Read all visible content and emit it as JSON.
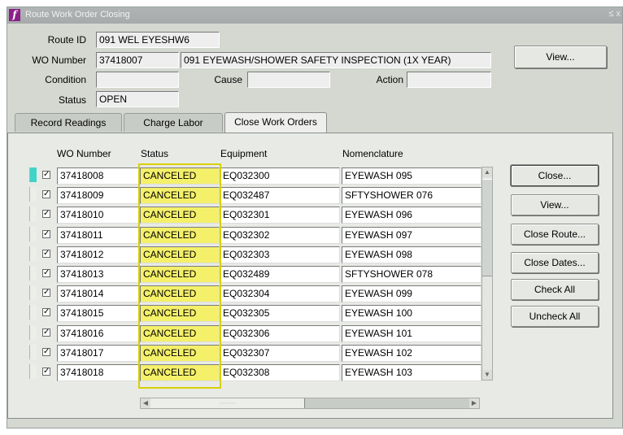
{
  "window": {
    "title": "Route Work Order Closing",
    "controls": "≤ x"
  },
  "header": {
    "route_id_label": "Route ID",
    "route_id_value": "091 WEL EYESHW6",
    "wo_number_label": "WO Number",
    "wo_number_value": "37418007",
    "wo_description": "091 EYEWASH/SHOWER SAFETY INSPECTION (1X YEAR)",
    "condition_label": "Condition",
    "condition_value": "",
    "cause_label": "Cause",
    "cause_value": "",
    "action_label": "Action",
    "action_value": "",
    "status_label": "Status",
    "status_value": "OPEN",
    "view_button": "View..."
  },
  "tabs": [
    {
      "label": "Record Readings",
      "active": false
    },
    {
      "label": "Charge Labor",
      "active": false
    },
    {
      "label": "Close Work Orders",
      "active": true
    }
  ],
  "table": {
    "columns": [
      "WO Number",
      "Status",
      "Equipment",
      "Nomenclature"
    ],
    "rows": [
      {
        "wo": "37418008",
        "status": "CANCELED",
        "equipment": "EQ032300",
        "nomenclature": "EYEWASH 095",
        "checked": true
      },
      {
        "wo": "37418009",
        "status": "CANCELED",
        "equipment": "EQ032487",
        "nomenclature": "SFTYSHOWER 076",
        "checked": true
      },
      {
        "wo": "37418010",
        "status": "CANCELED",
        "equipment": "EQ032301",
        "nomenclature": "EYEWASH 096",
        "checked": true
      },
      {
        "wo": "37418011",
        "status": "CANCELED",
        "equipment": "EQ032302",
        "nomenclature": "EYEWASH 097",
        "checked": true
      },
      {
        "wo": "37418012",
        "status": "CANCELED",
        "equipment": "EQ032303",
        "nomenclature": "EYEWASH 098",
        "checked": true
      },
      {
        "wo": "37418013",
        "status": "CANCELED",
        "equipment": "EQ032489",
        "nomenclature": "SFTYSHOWER 078",
        "checked": true
      },
      {
        "wo": "37418014",
        "status": "CANCELED",
        "equipment": "EQ032304",
        "nomenclature": "EYEWASH 099",
        "checked": true
      },
      {
        "wo": "37418015",
        "status": "CANCELED",
        "equipment": "EQ032305",
        "nomenclature": "EYEWASH 100",
        "checked": true
      },
      {
        "wo": "37418016",
        "status": "CANCELED",
        "equipment": "EQ032306",
        "nomenclature": "EYEWASH 101",
        "checked": true
      },
      {
        "wo": "37418017",
        "status": "CANCELED",
        "equipment": "EQ032307",
        "nomenclature": "EYEWASH 102",
        "checked": true
      },
      {
        "wo": "37418018",
        "status": "CANCELED",
        "equipment": "EQ032308",
        "nomenclature": "EYEWASH 103",
        "checked": true
      }
    ]
  },
  "actions": {
    "close": "Close...",
    "view": "View...",
    "close_route": "Close Route...",
    "close_dates": "Close Dates...",
    "check_all": "Check All",
    "uncheck_all": "Uncheck All"
  },
  "colors": {
    "status_highlight": "#f4f06a",
    "active_row_marker": "#3fd4c8",
    "app_icon": "#8a1f8a"
  }
}
